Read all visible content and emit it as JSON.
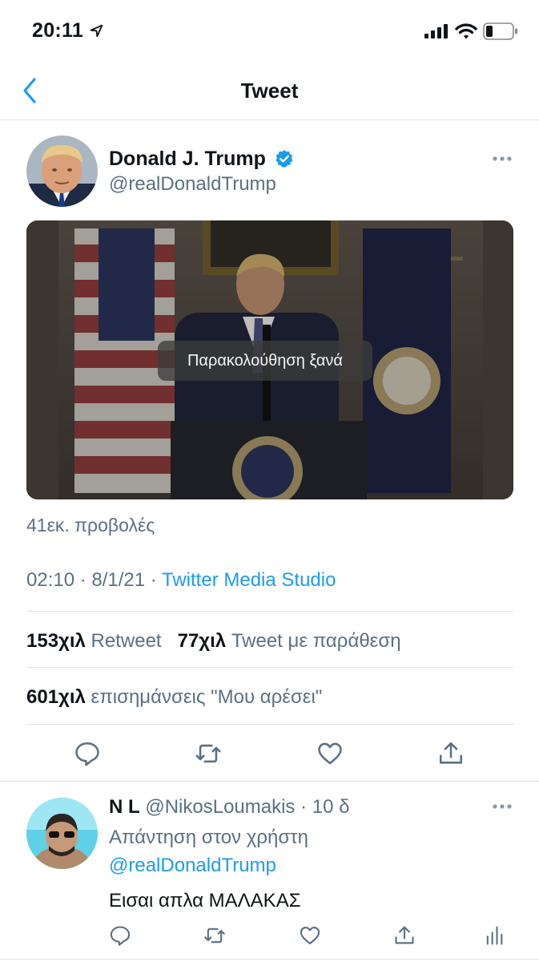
{
  "status_bar": {
    "time": "20:11"
  },
  "nav": {
    "title": "Tweet"
  },
  "tweet": {
    "author_name": "Donald J. Trump",
    "author_handle": "@realDonaldTrump",
    "video_overlay": "Παρακολούθηση ξανά",
    "views": "41εκ. προβολές",
    "time_date": "02:10 · 8/1/21 · ",
    "source": "Twitter Media Studio",
    "retweets_count": "153χιλ",
    "retweets_label": "Retweet",
    "quotes_count": "77χιλ",
    "quotes_label": "Tweet με παράθεση",
    "likes_count": "601χιλ",
    "likes_label": "επισημάνσεις \"Μου αρέσει\""
  },
  "reply": {
    "name": "N L",
    "handle": "@NikosLoumakis",
    "age": " · 10 δ",
    "replying_to_label": "Απάντηση στον χρήστη",
    "replying_to_handle": "@realDonaldTrump",
    "text": "Εισαι απλα ΜΑΛΑΚΑΣ"
  },
  "icons": {
    "actions": [
      "reply-icon",
      "retweet-icon",
      "like-icon",
      "share-icon"
    ],
    "reply_actions": [
      "reply-icon",
      "retweet-icon",
      "like-icon",
      "share-icon",
      "analytics-icon"
    ]
  },
  "colors": {
    "accent": "#1d9bf0",
    "secondary_text": "#5b7083",
    "divider": "#dde2e6"
  }
}
